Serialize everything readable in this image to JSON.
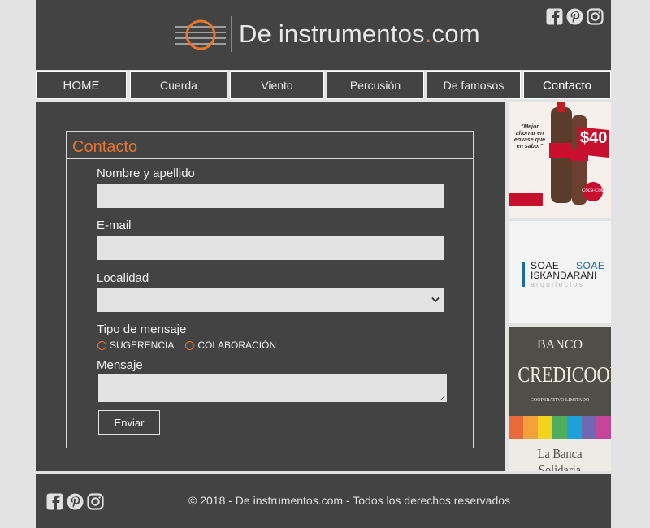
{
  "header": {
    "logo_text": "De instrumentos",
    "logo_dot": ".",
    "logo_tld": "com"
  },
  "nav": {
    "items": [
      "HOME",
      "Cuerda",
      "Viento",
      "Percusión",
      "De famosos",
      "Contacto"
    ],
    "active": "Contacto"
  },
  "form": {
    "title": "Contacto",
    "name_label": "Nombre y apellido",
    "email_label": "E-mail",
    "locality_label": "Localidad",
    "locality_value": "",
    "message_type_label": "Tipo de mensaje",
    "option_1": "SUGERENCIA",
    "option_2": "COLABORACIÓN",
    "message_label": "Mensaje",
    "submit_label": "Enviar"
  },
  "ads": {
    "ad1": {
      "tagline": "\"Mejor ahorrar en envase que en sabor\"",
      "price": "$40",
      "brand": "Coca-Cola"
    },
    "ad2": {
      "line1_left": "SOAE",
      "line1_right": "SOAE",
      "line2": "ISKANDARANI",
      "line3": "arquitectos"
    },
    "ad3": {
      "line1": "BANCO",
      "line2": "CREDICOOP",
      "line3": "COOPERATIVO LIMITADO",
      "line4": "La Banca Solidaria"
    }
  },
  "footer": {
    "copyright": "© 2018 - De instrumentos.com - Todos los derechos reservados"
  },
  "colors": {
    "accent": "#e7762e",
    "bg_dark": "#444343",
    "bg_light": "#e3e3e3"
  },
  "icons": [
    "facebook-icon",
    "pinterest-icon",
    "instagram-icon",
    "chevron-down-icon"
  ]
}
